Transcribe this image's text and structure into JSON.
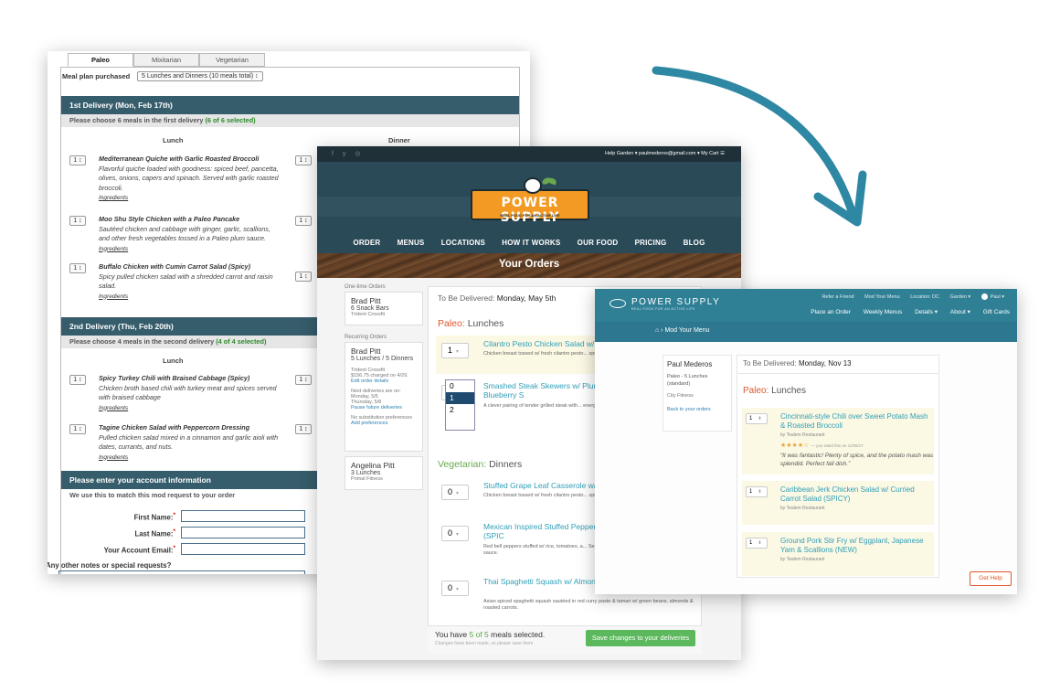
{
  "s1": {
    "tabs": [
      "Paleo",
      "Mixitarian",
      "Vegetarian"
    ],
    "meal_plan_label": "Meal plan purchased",
    "meal_plan_value": "5 Lunches and Dinners (10 meals total) ↕",
    "delivery1": {
      "title": "1st Delivery (Mon, Feb 17th)",
      "sub": "Please choose 6 meals in the first delivery",
      "sub_count": "(6 of 6 selected)",
      "lunch_header": "Lunch",
      "dinner_header": "Dinner",
      "meals": [
        {
          "qty": "1 ↕",
          "name": "Mediterranean Quiche with Garlic Roasted Broccoli",
          "desc": "Flavorful quiche loaded with goodness: spiced beef, pancetta, olives, onions, capers and spinach. Served with garlic roasted broccoli.",
          "link": "Ingredients"
        },
        {
          "qty": "1 ↕",
          "name": "Moo Shu Style Chicken with a Paleo Pancake",
          "desc": "Sautéed chicken and cabbage with ginger, garlic, scallions, and other fresh vegetables tossed in a Paleo plum sauce.",
          "link": "Ingredients"
        },
        {
          "qty": "1 ↕",
          "name": "Buffalo Chicken with Cumin Carrot Salad (Spicy)",
          "desc": "Spicy pulled chicken salad with a shredded carrot and raisin salad.",
          "link": "Ingredients"
        }
      ],
      "dinner_qty": [
        "1 ↕",
        "1 ↕",
        "1 ↕"
      ]
    },
    "delivery2": {
      "title": "2nd Delivery (Thu, Feb 20th)",
      "sub": "Please choose 4 meals in the second delivery",
      "sub_count": "(4 of 4 selected)",
      "lunch_header": "Lunch",
      "meals": [
        {
          "qty": "1 ↕",
          "name": "Spicy Turkey Chili with Braised Cabbage (Spicy)",
          "desc": "Chicken broth based chili with turkey meat and spices served with braised cabbage",
          "link": "Ingredients"
        },
        {
          "qty": "1 ↕",
          "name": "Tagine Chicken Salad with Peppercorn Dressing",
          "desc": "Pulled chicken salad mixed in a cinnamon and garlic aioli with dates, currants, and nuts.",
          "link": "Ingredients"
        }
      ],
      "dinner_qty": [
        "1 ↕",
        "1 ↕"
      ]
    },
    "account": {
      "title": "Please enter your account information",
      "sub": "We use this to match this mod request to your order",
      "first": "First Name:",
      "last": "Last Name:",
      "email": "Your Account Email:",
      "notes": "Any other notes or special requests?"
    }
  },
  "s2": {
    "social": "f y ◎",
    "topnav": "Help   Garden ▾   paulmederos@gmail.com ▾   My Cart ☰",
    "logo_text": "POWER SUPPLY",
    "logo_sub": "REAL FOOD FOR AN ACTIVE LIFE",
    "nav": [
      "ORDER",
      "MENUS",
      "LOCATIONS",
      "HOW IT WORKS",
      "OUR FOOD",
      "PRICING",
      "BLOG"
    ],
    "page_title": "Your Orders",
    "onetime_label": "One-time Orders",
    "onetime": {
      "name": "Brad Pitt",
      "detail": "6 Snack Bars",
      "sub": "Trident Crossfit"
    },
    "recurring_label": "Recurring Orders",
    "recurring": {
      "name": "Brad Pitt",
      "detail": "5 Lunches / 5 Dinners",
      "gym": "Trident Crossfit",
      "charge": "$156.75 charged on 4/29.",
      "edit": "Edit order details",
      "next": "Next deliveries are on:",
      "d1": "Monday, 5/5",
      "d2": "Thursday, 5/8",
      "pause": "Pause future deliveries",
      "nosub": "No substitution preferences",
      "addpref": "Add preferences"
    },
    "other": {
      "name": "Angelina Pitt",
      "detail": "3 Lunches",
      "sub": "Primal Fitness"
    },
    "deliver_label": "To Be Delivered:",
    "deliver_date": "Monday, May 5th",
    "sec1_cat": "Paleo:",
    "sec1_meal": "Lunches",
    "sec2_cat": "Vegetarian:",
    "sec2_meal": "Dinners",
    "rows": [
      {
        "qty": "1",
        "title": "Cilantro Pesto Chicken Salad w/",
        "desc": "Chicken breast tossed w/ fresh cilantro pesto... spring lettuce topped w/ bacon, egg crumble..."
      },
      {
        "qty": "1",
        "title": "Smashed Steak Skewers w/ Plum Sweet Potato-Bacon-Blueberry S",
        "desc": "A clever pairing of tender grilled steak with... energy boosting side salad (yes, there's ba..."
      },
      {
        "qty": "0",
        "title": "Stuffed Grape Leaf Casserole w/",
        "desc": "Chicken breast tossed w/ fresh cilantro pesto... spring lettuce topped w/ bacon, egg crumble..."
      },
      {
        "qty": "0",
        "title": "Mexican Inspired Stuffed Pepper Vegetables & Sofrito Sauce (SPIC",
        "desc": "Red bell peppers stuffed w/ rice, tomatoes, a... Served w/ a grilled vegetable medley & toma... sauce."
      },
      {
        "qty": "0",
        "title": "Thai Spaghetti Squash w/ Almon Carrots (SPICY)",
        "desc": "Asian spiced spaghetti squash sautéed in red curry paste & tamari w/ green beans, almonds & roasted carrots."
      }
    ],
    "dropdown": [
      "0",
      "1",
      "2"
    ],
    "footer_prefix": "You have",
    "footer_count": "5 of 5",
    "footer_suffix": "meals selected.",
    "footer_note": "Changes have been made, so please save them",
    "save_label": "Save changes to your deliveries"
  },
  "s3": {
    "logo_text": "POWER SUPPLY",
    "logo_sub": "REAL FOOD FOR AN ACTIVE LIFE",
    "top_links": [
      "Refer a Friend",
      "Mod Your Menu",
      "Location: DC",
      "Garden ▾",
      "Paul ▾"
    ],
    "main_links": [
      "Place an Order",
      "Weekly Menus",
      "Details ▾",
      "About ▾",
      "Gift Cards"
    ],
    "crumb": "⌂ › Mod Your Menu",
    "card": {
      "name": "Paul Mederos",
      "plan": "Paleo - 5 Lunches (standard)",
      "gym": "City Fitness",
      "back": "Back to your orders"
    },
    "deliver_label": "To Be Delivered:",
    "deliver_date": "Monday, Nov 13",
    "sec_cat": "Paleo:",
    "sec_meal": "Lunches",
    "meals": [
      {
        "qty": "1",
        "title": "Cincinnati-style Chili over Sweet Potato Mash & Roasted Broccoli",
        "by": "by Tealem Restaurant",
        "stars": "★★★★☆",
        "rated": "— you rated this on 11/08/17",
        "quote": "“It was fantastic! Plenty of spice, and the potato mash was splendid. Perfect fall dish.”"
      },
      {
        "qty": "1",
        "title": "Caribbean Jerk Chicken Salad w/ Curried Carrot Salad (SPICY)",
        "by": "by Tealem Restaurant"
      },
      {
        "qty": "1",
        "title": "Ground Pork Stir Fry w/ Eggplant, Japanese Yam & Scallions (NEW)",
        "by": "by Tealem Restaurant"
      }
    ],
    "help_label": "Get Help"
  },
  "colors": {
    "teal": "#2f7f95",
    "accent": "#e0562c",
    "green": "#5cb85c",
    "arrow": "#2f88a3"
  }
}
